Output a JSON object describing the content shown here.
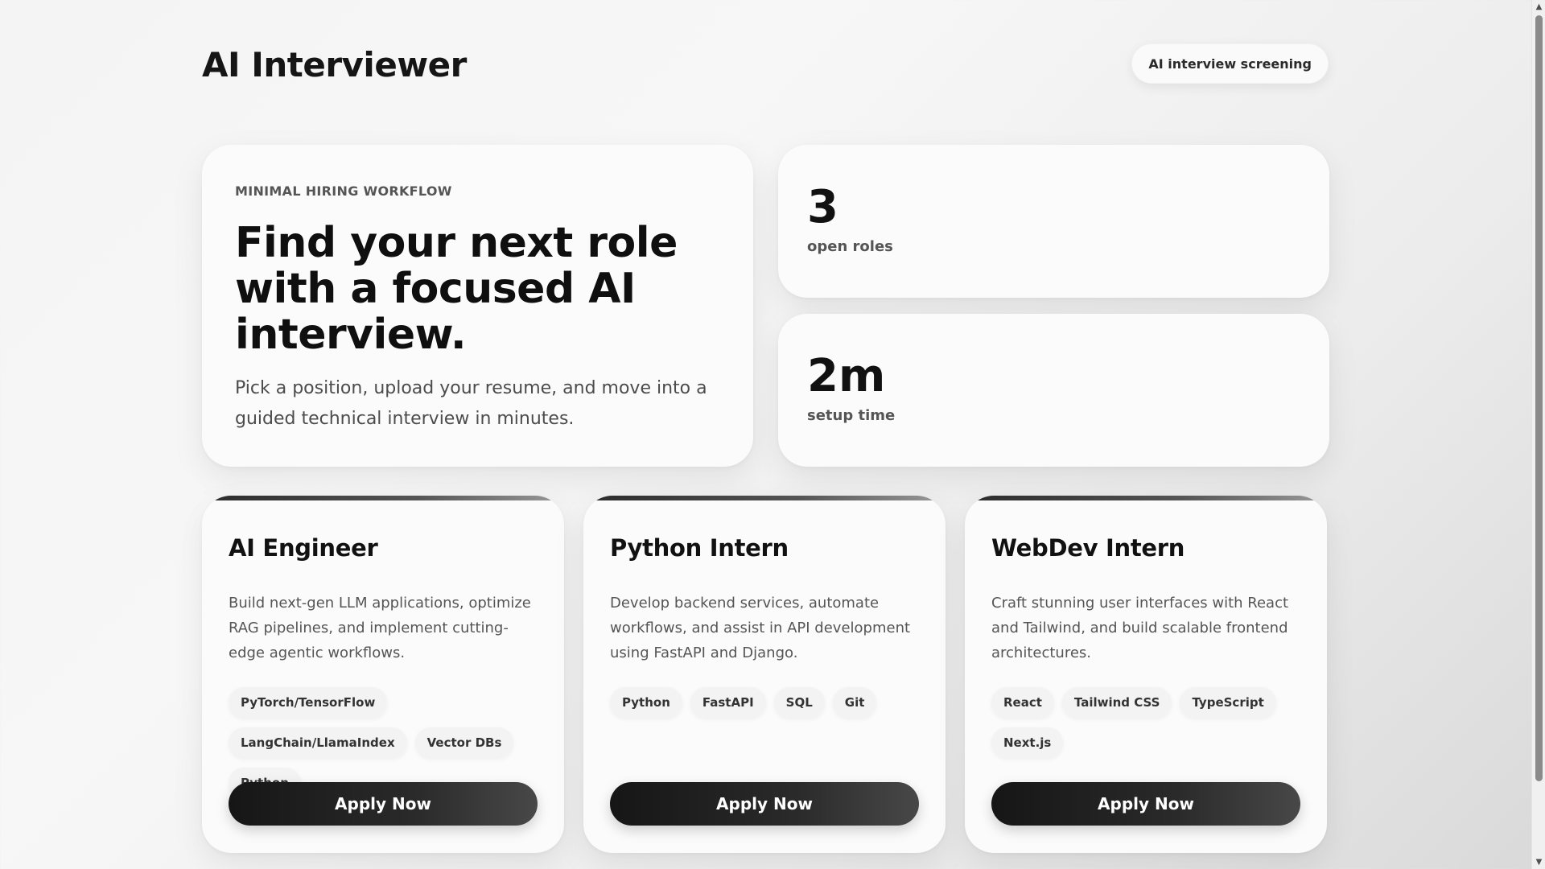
{
  "header": {
    "title": "AI Interviewer",
    "badge": "AI interview screening"
  },
  "hero": {
    "eyebrow": "MINIMAL HIRING WORKFLOW",
    "title": "Find your next role with a focused AI interview.",
    "description": "Pick a position, upload your resume, and move into a guided technical interview in minutes."
  },
  "stats": [
    {
      "value": "3",
      "label": "open roles"
    },
    {
      "value": "2m",
      "label": "setup time"
    }
  ],
  "jobs": [
    {
      "title": "AI Engineer",
      "description": "Build next-gen LLM applications, optimize RAG pipelines, and implement cutting-edge agentic workflows.",
      "tags": [
        "PyTorch/TensorFlow",
        "LangChain/LlamaIndex",
        "Vector DBs",
        "Python"
      ],
      "button": "Apply Now"
    },
    {
      "title": "Python Intern",
      "description": "Develop backend services, automate workflows, and assist in API development using FastAPI and Django.",
      "tags": [
        "Python",
        "FastAPI",
        "SQL",
        "Git"
      ],
      "button": "Apply Now"
    },
    {
      "title": "WebDev Intern",
      "description": "Craft stunning user interfaces with React and Tailwind, and build scalable frontend architectures.",
      "tags": [
        "React",
        "Tailwind CSS",
        "TypeScript",
        "Next.js"
      ],
      "button": "Apply Now"
    }
  ],
  "scrollbar": {
    "up_icon": "▲",
    "down_icon": "▼"
  },
  "colors": {
    "button_dark": "#161616",
    "background": "#f4f4f4",
    "card": "#fbfbfb"
  }
}
